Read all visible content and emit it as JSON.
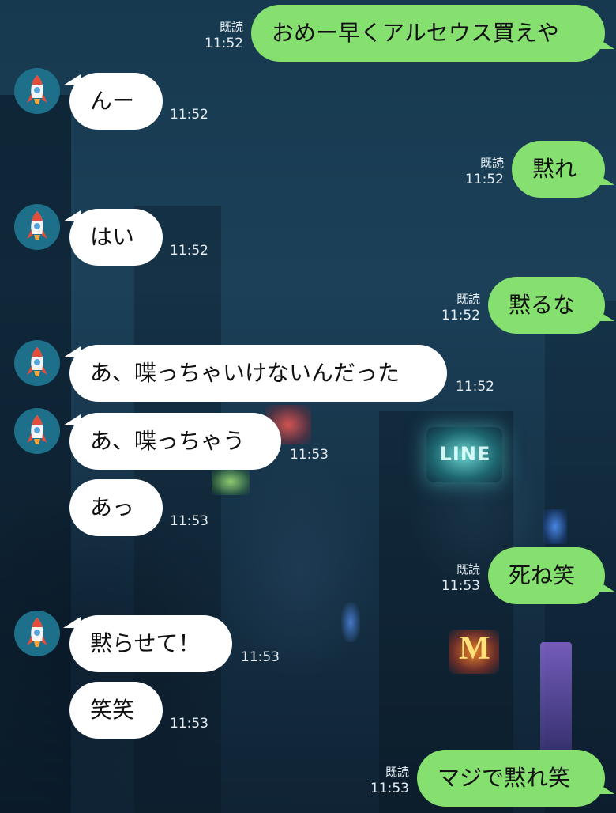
{
  "colors": {
    "sent_bubble": "#85e070",
    "received_bubble": "#ffffff",
    "avatar_bg": "#1e6f8a",
    "meta_text": "#e6edf2"
  },
  "background": {
    "neon_sign_text": "LINE"
  },
  "messages": [
    {
      "side": "sent",
      "text": "おめー早くアルセウス買えや",
      "read": "既読",
      "time": "11:52"
    },
    {
      "side": "received",
      "text": "んー",
      "time": "11:52",
      "avatar": "rocket-icon"
    },
    {
      "side": "sent",
      "text": "黙れ",
      "read": "既読",
      "time": "11:52"
    },
    {
      "side": "received",
      "text": "はい",
      "time": "11:52",
      "avatar": "rocket-icon"
    },
    {
      "side": "sent",
      "text": "黙るな",
      "read": "既読",
      "time": "11:52"
    },
    {
      "side": "received",
      "text": "あ、喋っちゃいけないんだった",
      "time": "11:52",
      "avatar": "rocket-icon"
    },
    {
      "side": "received",
      "text": "あ、喋っちゃう",
      "time": "11:53",
      "avatar": "rocket-icon"
    },
    {
      "side": "received",
      "text": "あっ",
      "time": "11:53"
    },
    {
      "side": "sent",
      "text": "死ね笑",
      "read": "既読",
      "time": "11:53"
    },
    {
      "side": "received",
      "text": "黙らせて！",
      "time": "11:53",
      "avatar": "rocket-icon"
    },
    {
      "side": "received",
      "text": "笑笑",
      "time": "11:53"
    },
    {
      "side": "sent",
      "text": "マジで黙れ笑",
      "read": "既読",
      "time": "11:53"
    }
  ]
}
